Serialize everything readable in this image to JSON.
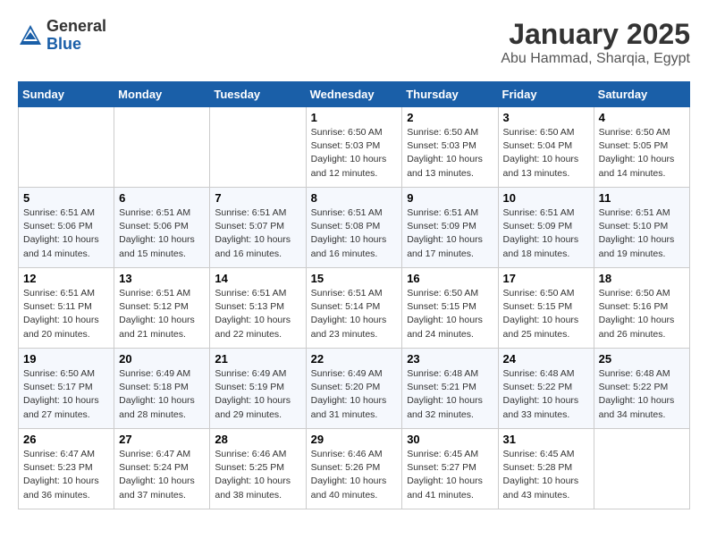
{
  "logo": {
    "general": "General",
    "blue": "Blue"
  },
  "header": {
    "month": "January 2025",
    "location": "Abu Hammad, Sharqia, Egypt"
  },
  "weekdays": [
    "Sunday",
    "Monday",
    "Tuesday",
    "Wednesday",
    "Thursday",
    "Friday",
    "Saturday"
  ],
  "weeks": [
    [
      {
        "day": "",
        "info": ""
      },
      {
        "day": "",
        "info": ""
      },
      {
        "day": "",
        "info": ""
      },
      {
        "day": "1",
        "info": "Sunrise: 6:50 AM\nSunset: 5:03 PM\nDaylight: 10 hours\nand 12 minutes."
      },
      {
        "day": "2",
        "info": "Sunrise: 6:50 AM\nSunset: 5:03 PM\nDaylight: 10 hours\nand 13 minutes."
      },
      {
        "day": "3",
        "info": "Sunrise: 6:50 AM\nSunset: 5:04 PM\nDaylight: 10 hours\nand 13 minutes."
      },
      {
        "day": "4",
        "info": "Sunrise: 6:50 AM\nSunset: 5:05 PM\nDaylight: 10 hours\nand 14 minutes."
      }
    ],
    [
      {
        "day": "5",
        "info": "Sunrise: 6:51 AM\nSunset: 5:06 PM\nDaylight: 10 hours\nand 14 minutes."
      },
      {
        "day": "6",
        "info": "Sunrise: 6:51 AM\nSunset: 5:06 PM\nDaylight: 10 hours\nand 15 minutes."
      },
      {
        "day": "7",
        "info": "Sunrise: 6:51 AM\nSunset: 5:07 PM\nDaylight: 10 hours\nand 16 minutes."
      },
      {
        "day": "8",
        "info": "Sunrise: 6:51 AM\nSunset: 5:08 PM\nDaylight: 10 hours\nand 16 minutes."
      },
      {
        "day": "9",
        "info": "Sunrise: 6:51 AM\nSunset: 5:09 PM\nDaylight: 10 hours\nand 17 minutes."
      },
      {
        "day": "10",
        "info": "Sunrise: 6:51 AM\nSunset: 5:09 PM\nDaylight: 10 hours\nand 18 minutes."
      },
      {
        "day": "11",
        "info": "Sunrise: 6:51 AM\nSunset: 5:10 PM\nDaylight: 10 hours\nand 19 minutes."
      }
    ],
    [
      {
        "day": "12",
        "info": "Sunrise: 6:51 AM\nSunset: 5:11 PM\nDaylight: 10 hours\nand 20 minutes."
      },
      {
        "day": "13",
        "info": "Sunrise: 6:51 AM\nSunset: 5:12 PM\nDaylight: 10 hours\nand 21 minutes."
      },
      {
        "day": "14",
        "info": "Sunrise: 6:51 AM\nSunset: 5:13 PM\nDaylight: 10 hours\nand 22 minutes."
      },
      {
        "day": "15",
        "info": "Sunrise: 6:51 AM\nSunset: 5:14 PM\nDaylight: 10 hours\nand 23 minutes."
      },
      {
        "day": "16",
        "info": "Sunrise: 6:50 AM\nSunset: 5:15 PM\nDaylight: 10 hours\nand 24 minutes."
      },
      {
        "day": "17",
        "info": "Sunrise: 6:50 AM\nSunset: 5:15 PM\nDaylight: 10 hours\nand 25 minutes."
      },
      {
        "day": "18",
        "info": "Sunrise: 6:50 AM\nSunset: 5:16 PM\nDaylight: 10 hours\nand 26 minutes."
      }
    ],
    [
      {
        "day": "19",
        "info": "Sunrise: 6:50 AM\nSunset: 5:17 PM\nDaylight: 10 hours\nand 27 minutes."
      },
      {
        "day": "20",
        "info": "Sunrise: 6:49 AM\nSunset: 5:18 PM\nDaylight: 10 hours\nand 28 minutes."
      },
      {
        "day": "21",
        "info": "Sunrise: 6:49 AM\nSunset: 5:19 PM\nDaylight: 10 hours\nand 29 minutes."
      },
      {
        "day": "22",
        "info": "Sunrise: 6:49 AM\nSunset: 5:20 PM\nDaylight: 10 hours\nand 31 minutes."
      },
      {
        "day": "23",
        "info": "Sunrise: 6:48 AM\nSunset: 5:21 PM\nDaylight: 10 hours\nand 32 minutes."
      },
      {
        "day": "24",
        "info": "Sunrise: 6:48 AM\nSunset: 5:22 PM\nDaylight: 10 hours\nand 33 minutes."
      },
      {
        "day": "25",
        "info": "Sunrise: 6:48 AM\nSunset: 5:22 PM\nDaylight: 10 hours\nand 34 minutes."
      }
    ],
    [
      {
        "day": "26",
        "info": "Sunrise: 6:47 AM\nSunset: 5:23 PM\nDaylight: 10 hours\nand 36 minutes."
      },
      {
        "day": "27",
        "info": "Sunrise: 6:47 AM\nSunset: 5:24 PM\nDaylight: 10 hours\nand 37 minutes."
      },
      {
        "day": "28",
        "info": "Sunrise: 6:46 AM\nSunset: 5:25 PM\nDaylight: 10 hours\nand 38 minutes."
      },
      {
        "day": "29",
        "info": "Sunrise: 6:46 AM\nSunset: 5:26 PM\nDaylight: 10 hours\nand 40 minutes."
      },
      {
        "day": "30",
        "info": "Sunrise: 6:45 AM\nSunset: 5:27 PM\nDaylight: 10 hours\nand 41 minutes."
      },
      {
        "day": "31",
        "info": "Sunrise: 6:45 AM\nSunset: 5:28 PM\nDaylight: 10 hours\nand 43 minutes."
      },
      {
        "day": "",
        "info": ""
      }
    ]
  ]
}
